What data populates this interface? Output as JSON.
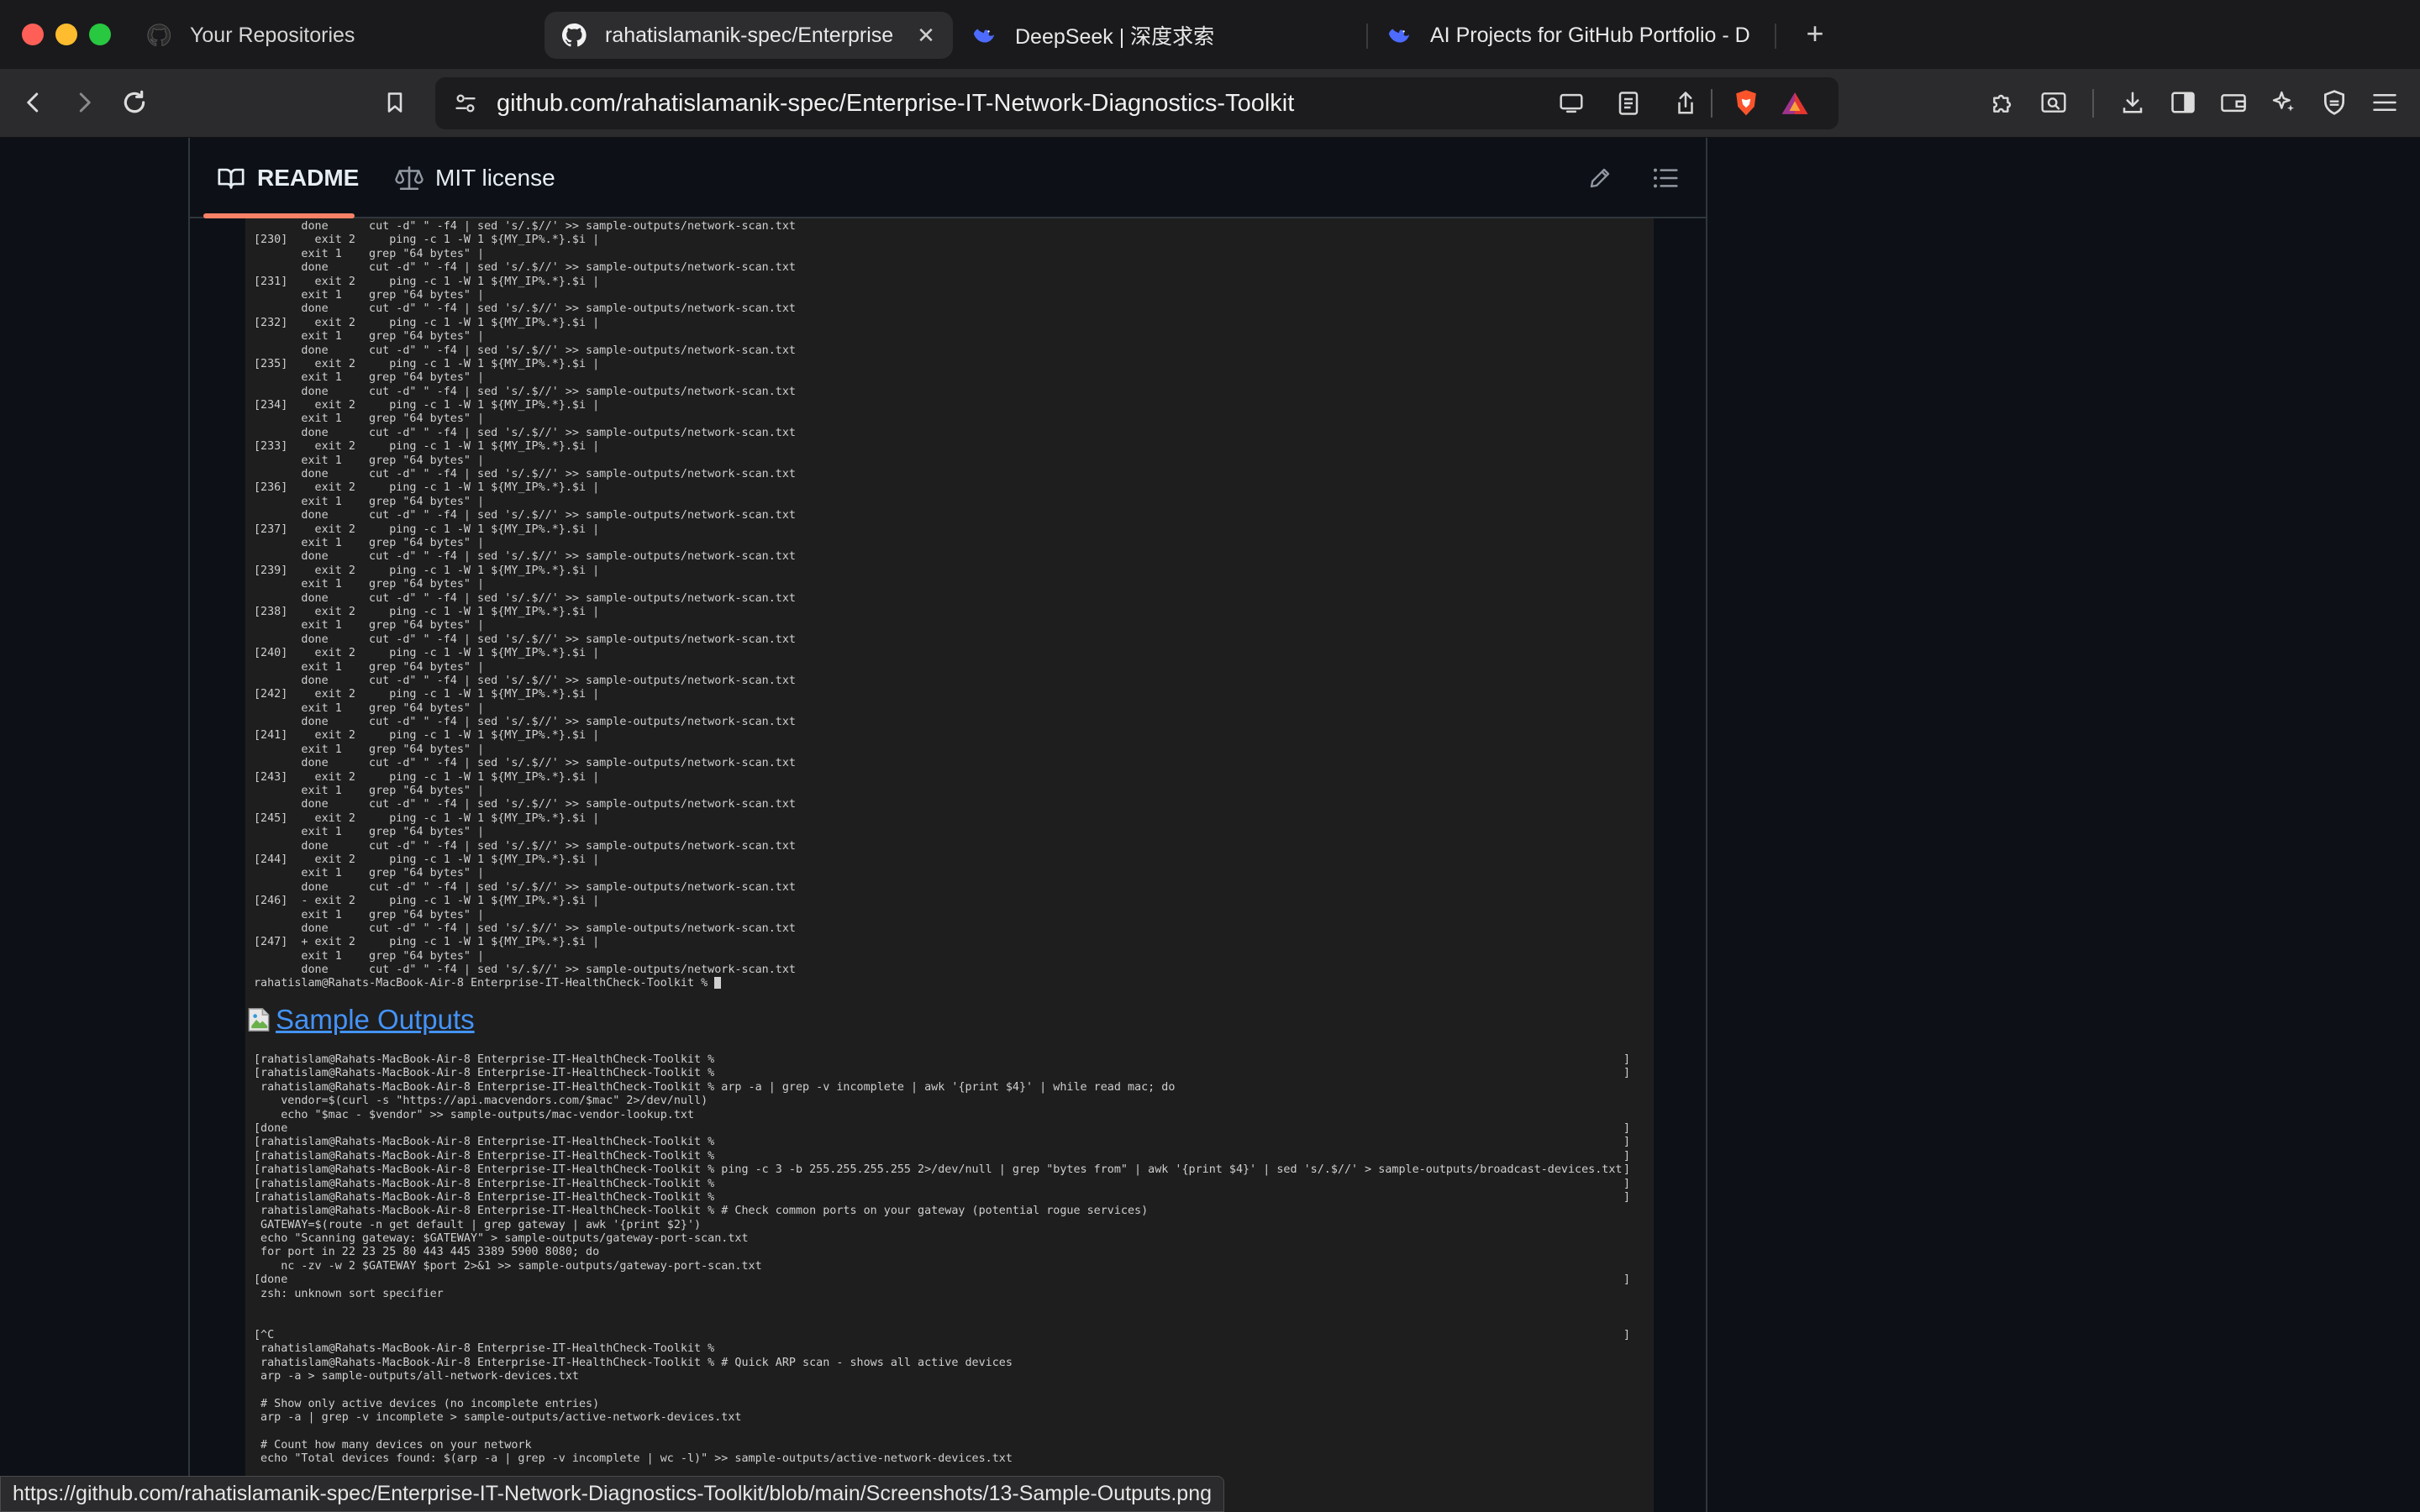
{
  "browser": {
    "tabs": [
      {
        "label": "Your Repositories",
        "icon": "github-icon",
        "active": false
      },
      {
        "label": "rahatislamanik-spec/Enterprise",
        "icon": "github-icon",
        "active": true
      },
      {
        "label": "DeepSeek | 深度求索",
        "icon": "deepseek-icon",
        "active": false
      },
      {
        "label": "AI Projects for GitHub Portfolio - D",
        "icon": "deepseek-icon",
        "active": false
      }
    ],
    "new_tab_label": "+",
    "url": "github.com/rahatislamanik-spec/Enterprise-IT-Network-Diagnostics-Toolkit",
    "status_url": "https://github.com/rahatislamanik-spec/Enterprise-IT-Network-Diagnostics-Toolkit/blob/main/Screenshots/13-Sample-Outputs.png",
    "colors": {
      "close": "#ff5f57",
      "minimize": "#febc2e",
      "zoom": "#28c840",
      "accent": "#f78166",
      "link": "#4493f8",
      "brave": "#fb542b"
    }
  },
  "readme": {
    "tabs": [
      {
        "label": "README",
        "icon": "book-icon"
      },
      {
        "label": "MIT license",
        "icon": "scale-icon"
      }
    ],
    "section_link": "Sample Outputs",
    "terminal1_lines": [
      "       done      cut -d\" \" -f4 | sed 's/.$//' >> sample-outputs/network-scan.txt",
      "[230]    exit 2     ping -c 1 -W 1 ${MY_IP%.*}.$i |",
      "       exit 1    grep \"64 bytes\" |",
      "       done      cut -d\" \" -f4 | sed 's/.$//' >> sample-outputs/network-scan.txt",
      "[231]    exit 2     ping -c 1 -W 1 ${MY_IP%.*}.$i |",
      "       exit 1    grep \"64 bytes\" |",
      "       done      cut -d\" \" -f4 | sed 's/.$//' >> sample-outputs/network-scan.txt",
      "[232]    exit 2     ping -c 1 -W 1 ${MY_IP%.*}.$i |",
      "       exit 1    grep \"64 bytes\" |",
      "       done      cut -d\" \" -f4 | sed 's/.$//' >> sample-outputs/network-scan.txt",
      "[235]    exit 2     ping -c 1 -W 1 ${MY_IP%.*}.$i |",
      "       exit 1    grep \"64 bytes\" |",
      "       done      cut -d\" \" -f4 | sed 's/.$//' >> sample-outputs/network-scan.txt",
      "[234]    exit 2     ping -c 1 -W 1 ${MY_IP%.*}.$i |",
      "       exit 1    grep \"64 bytes\" |",
      "       done      cut -d\" \" -f4 | sed 's/.$//' >> sample-outputs/network-scan.txt",
      "[233]    exit 2     ping -c 1 -W 1 ${MY_IP%.*}.$i |",
      "       exit 1    grep \"64 bytes\" |",
      "       done      cut -d\" \" -f4 | sed 's/.$//' >> sample-outputs/network-scan.txt",
      "[236]    exit 2     ping -c 1 -W 1 ${MY_IP%.*}.$i |",
      "       exit 1    grep \"64 bytes\" |",
      "       done      cut -d\" \" -f4 | sed 's/.$//' >> sample-outputs/network-scan.txt",
      "[237]    exit 2     ping -c 1 -W 1 ${MY_IP%.*}.$i |",
      "       exit 1    grep \"64 bytes\" |",
      "       done      cut -d\" \" -f4 | sed 's/.$//' >> sample-outputs/network-scan.txt",
      "[239]    exit 2     ping -c 1 -W 1 ${MY_IP%.*}.$i |",
      "       exit 1    grep \"64 bytes\" |",
      "       done      cut -d\" \" -f4 | sed 's/.$//' >> sample-outputs/network-scan.txt",
      "[238]    exit 2     ping -c 1 -W 1 ${MY_IP%.*}.$i |",
      "       exit 1    grep \"64 bytes\" |",
      "       done      cut -d\" \" -f4 | sed 's/.$//' >> sample-outputs/network-scan.txt",
      "[240]    exit 2     ping -c 1 -W 1 ${MY_IP%.*}.$i |",
      "       exit 1    grep \"64 bytes\" |",
      "       done      cut -d\" \" -f4 | sed 's/.$//' >> sample-outputs/network-scan.txt",
      "[242]    exit 2     ping -c 1 -W 1 ${MY_IP%.*}.$i |",
      "       exit 1    grep \"64 bytes\" |",
      "       done      cut -d\" \" -f4 | sed 's/.$//' >> sample-outputs/network-scan.txt",
      "[241]    exit 2     ping -c 1 -W 1 ${MY_IP%.*}.$i |",
      "       exit 1    grep \"64 bytes\" |",
      "       done      cut -d\" \" -f4 | sed 's/.$//' >> sample-outputs/network-scan.txt",
      "[243]    exit 2     ping -c 1 -W 1 ${MY_IP%.*}.$i |",
      "       exit 1    grep \"64 bytes\" |",
      "       done      cut -d\" \" -f4 | sed 's/.$//' >> sample-outputs/network-scan.txt",
      "[245]    exit 2     ping -c 1 -W 1 ${MY_IP%.*}.$i |",
      "       exit 1    grep \"64 bytes\" |",
      "       done      cut -d\" \" -f4 | sed 's/.$//' >> sample-outputs/network-scan.txt",
      "[244]    exit 2     ping -c 1 -W 1 ${MY_IP%.*}.$i |",
      "       exit 1    grep \"64 bytes\" |",
      "       done      cut -d\" \" -f4 | sed 's/.$//' >> sample-outputs/network-scan.txt",
      "[246]  - exit 2     ping -c 1 -W 1 ${MY_IP%.*}.$i |",
      "       exit 1    grep \"64 bytes\" |",
      "       done      cut -d\" \" -f4 | sed 's/.$//' >> sample-outputs/network-scan.txt",
      "[247]  + exit 2     ping -c 1 -W 1 ${MY_IP%.*}.$i |",
      "       exit 1    grep \"64 bytes\" |",
      "       done      cut -d\" \" -f4 | sed 's/.$//' >> sample-outputs/network-scan.txt",
      "rahatislam@Rahats-MacBook-Air-8 Enterprise-IT-HealthCheck-Toolkit % "
    ],
    "terminal2_lines": [
      {
        "text": "[rahatislam@Rahats-MacBook-Air-8 Enterprise-IT-HealthCheck-Toolkit %",
        "bracket": "]"
      },
      {
        "text": "[rahatislam@Rahats-MacBook-Air-8 Enterprise-IT-HealthCheck-Toolkit %",
        "bracket": "]"
      },
      {
        "text": " rahatislam@Rahats-MacBook-Air-8 Enterprise-IT-HealthCheck-Toolkit % arp -a | grep -v incomplete | awk '{print $4}' | while read mac; do",
        "bracket": ""
      },
      {
        "text": "    vendor=$(curl -s \"https://api.macvendors.com/$mac\" 2>/dev/null)",
        "bracket": ""
      },
      {
        "text": "    echo \"$mac - $vendor\" >> sample-outputs/mac-vendor-lookup.txt",
        "bracket": ""
      },
      {
        "text": "[done",
        "bracket": "]"
      },
      {
        "text": "[rahatislam@Rahats-MacBook-Air-8 Enterprise-IT-HealthCheck-Toolkit %",
        "bracket": "]"
      },
      {
        "text": "[rahatislam@Rahats-MacBook-Air-8 Enterprise-IT-HealthCheck-Toolkit %",
        "bracket": "]"
      },
      {
        "text": "[rahatislam@Rahats-MacBook-Air-8 Enterprise-IT-HealthCheck-Toolkit % ping -c 3 -b 255.255.255.255 2>/dev/null | grep \"bytes from\" | awk '{print $4}' | sed 's/.$//' > sample-outputs/broadcast-devices.txt",
        "bracket": "]"
      },
      {
        "text": "[rahatislam@Rahats-MacBook-Air-8 Enterprise-IT-HealthCheck-Toolkit %",
        "bracket": "]"
      },
      {
        "text": "[rahatislam@Rahats-MacBook-Air-8 Enterprise-IT-HealthCheck-Toolkit %",
        "bracket": "]"
      },
      {
        "text": " rahatislam@Rahats-MacBook-Air-8 Enterprise-IT-HealthCheck-Toolkit % # Check common ports on your gateway (potential rogue services)",
        "bracket": ""
      },
      {
        "text": " GATEWAY=$(route -n get default | grep gateway | awk '{print $2}')",
        "bracket": ""
      },
      {
        "text": " echo \"Scanning gateway: $GATEWAY\" > sample-outputs/gateway-port-scan.txt",
        "bracket": ""
      },
      {
        "text": " for port in 22 23 25 80 443 445 3389 5900 8080; do",
        "bracket": ""
      },
      {
        "text": "    nc -zv -w 2 $GATEWAY $port 2>&1 >> sample-outputs/gateway-port-scan.txt",
        "bracket": ""
      },
      {
        "text": "[done",
        "bracket": "]"
      },
      {
        "text": " zsh: unknown sort specifier",
        "bracket": ""
      },
      {
        "text": "",
        "bracket": ""
      },
      {
        "text": "",
        "bracket": ""
      },
      {
        "text": "[^C",
        "bracket": "]"
      },
      {
        "text": " rahatislam@Rahats-MacBook-Air-8 Enterprise-IT-HealthCheck-Toolkit %",
        "bracket": ""
      },
      {
        "text": " rahatislam@Rahats-MacBook-Air-8 Enterprise-IT-HealthCheck-Toolkit % # Quick ARP scan - shows all active devices",
        "bracket": ""
      },
      {
        "text": " arp -a > sample-outputs/all-network-devices.txt",
        "bracket": ""
      },
      {
        "text": "",
        "bracket": ""
      },
      {
        "text": " # Show only active devices (no incomplete entries)",
        "bracket": ""
      },
      {
        "text": " arp -a | grep -v incomplete > sample-outputs/active-network-devices.txt",
        "bracket": ""
      },
      {
        "text": "",
        "bracket": ""
      },
      {
        "text": " # Count how many devices on your network",
        "bracket": ""
      },
      {
        "text": " echo \"Total devices found: $(arp -a | grep -v incomplete | wc -l)\" >> sample-outputs/active-network-devices.txt",
        "bracket": ""
      }
    ]
  }
}
